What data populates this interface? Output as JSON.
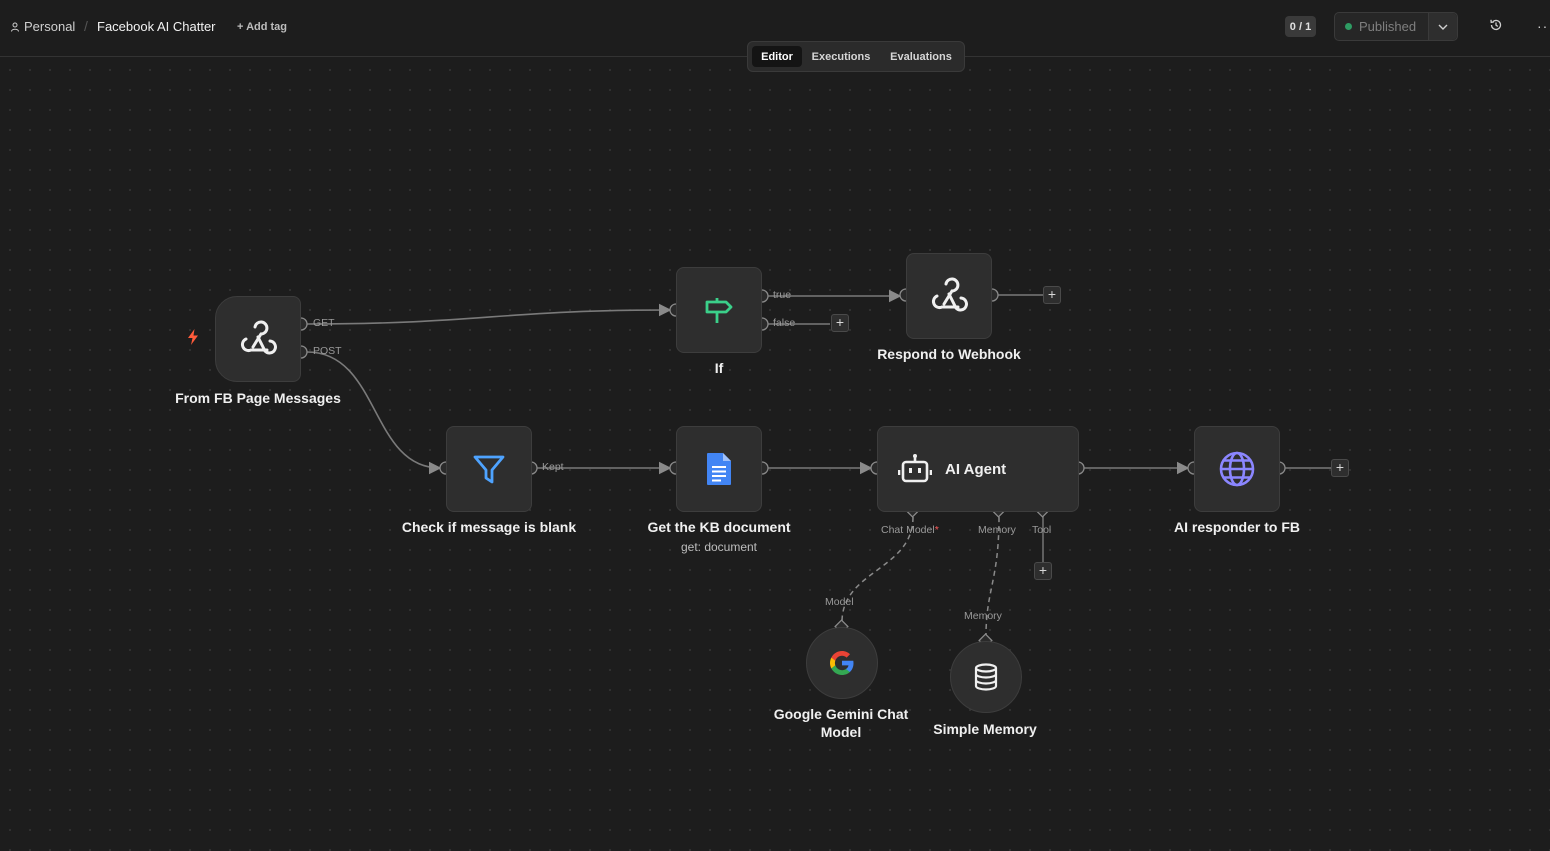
{
  "header": {
    "breadcrumb_personal": "Personal",
    "breadcrumb_sep": "/",
    "workflow_title": "Facebook AI Chatter",
    "add_tag": "+ Add tag",
    "counter": "0 / 1",
    "publish_status": "Published",
    "more": "···"
  },
  "tabs": [
    {
      "label": "Editor",
      "active": true
    },
    {
      "label": "Executions",
      "active": false
    },
    {
      "label": "Evaluations",
      "active": false
    }
  ],
  "nodes": {
    "trigger": {
      "label": "From FB Page Messages",
      "icon": "webhook-icon"
    },
    "if": {
      "label": "If",
      "icon": "signpost-icon"
    },
    "respond": {
      "label": "Respond to Webhook",
      "icon": "webhook-icon"
    },
    "filter": {
      "label": "Check if message is blank",
      "icon": "funnel-icon"
    },
    "doc": {
      "label": "Get the KB document",
      "sublabel": "get: document",
      "icon": "google-docs-icon"
    },
    "agent": {
      "label": "AI Agent",
      "icon": "robot-icon"
    },
    "http": {
      "label": "AI responder to FB",
      "icon": "globe-icon"
    },
    "gemini": {
      "label": "Google Gemini Chat Model",
      "icon": "google-icon"
    },
    "memory": {
      "label": "Simple Memory",
      "icon": "database-icon"
    }
  },
  "ports": {
    "get": "GET",
    "post": "POST",
    "true": "true",
    "false": "false",
    "kept": "Kept",
    "chat_model": "Chat Model",
    "chat_model_required": "*",
    "memory": "Memory",
    "tool": "Tool",
    "model_in": "Model",
    "memory_in": "Memory"
  },
  "colors": {
    "canvas": "#1d1d1d",
    "node": "#2e2e2e",
    "if_icon": "#3bd08a",
    "filter_icon": "#4ea3ff",
    "globe_icon": "#8b86ff",
    "trigger_bolt": "#ff5b3a",
    "published_dot": "#2e9c63"
  }
}
